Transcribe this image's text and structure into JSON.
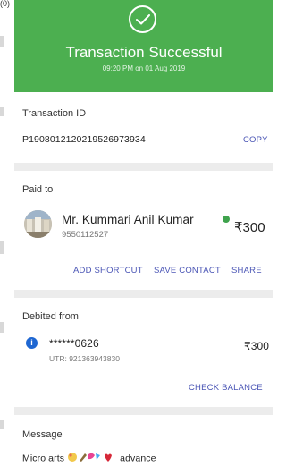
{
  "corner_mark": "(0)",
  "header": {
    "title": "Transaction Successful",
    "subtitle": "09:20 PM on 01 Aug 2019",
    "accent": "#4caf50"
  },
  "transaction": {
    "label": "Transaction ID",
    "id": "P1908012120219526973934",
    "copy_label": "COPY"
  },
  "paid_to": {
    "label": "Paid to",
    "name": "Mr. Kummari Anil Kumar",
    "phone": "9550112527",
    "amount": "₹300",
    "actions": [
      "ADD SHORTCUT",
      "SAVE CONTACT",
      "SHARE"
    ]
  },
  "debited_from": {
    "label": "Debited from",
    "account": "******0626",
    "utr": "UTR: 921363943830",
    "amount": "₹300",
    "check_balance_label": "CHECK BALANCE"
  },
  "message": {
    "label": "Message",
    "text_prefix": "Micro arts",
    "text_suffix": "advance"
  }
}
